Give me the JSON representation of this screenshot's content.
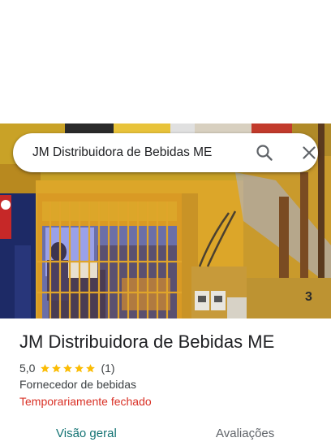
{
  "search": {
    "query": "JM Distribuidora de Bebidas ME"
  },
  "place": {
    "title": "JM Distribuidora de Bebidas ME",
    "rating": "5,0",
    "stars": 5,
    "review_count": "(1)",
    "category": "Fornecedor de bebidas",
    "status": "Temporariamente fechado"
  },
  "tabs": [
    {
      "label": "Visão geral",
      "active": true
    },
    {
      "label": "Avaliações",
      "active": false
    }
  ],
  "colors": {
    "accent_tab": "#137373",
    "status_closed": "#d93025",
    "star": "#fbbc04"
  },
  "icons": {
    "search": "search-icon",
    "close": "close-icon",
    "star": "star-icon"
  },
  "photo": {
    "store_number": "3"
  }
}
